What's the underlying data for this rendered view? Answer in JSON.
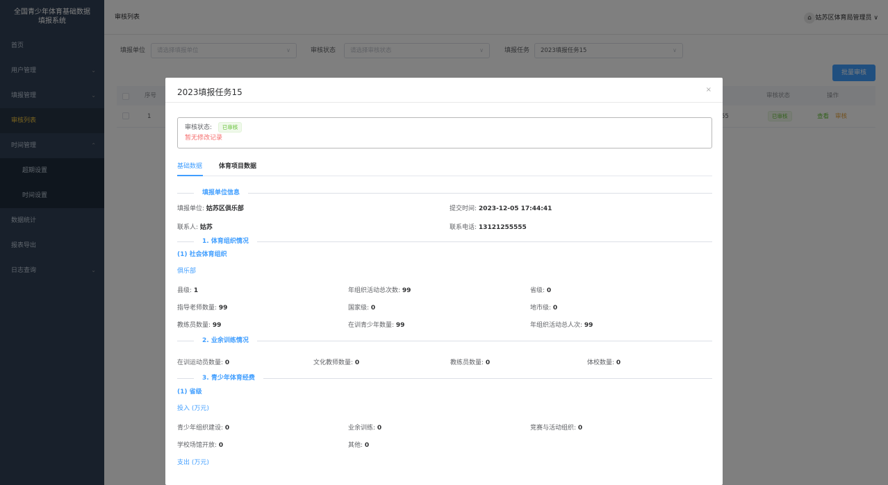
{
  "sidebar": {
    "title": "全国青少年体育基础数据填报系统",
    "items": [
      {
        "label": "首页",
        "arrow": ""
      },
      {
        "label": "用户管理",
        "arrow": "⌄"
      },
      {
        "label": "填报管理",
        "arrow": "⌄"
      },
      {
        "label": "审核列表",
        "arrow": ""
      },
      {
        "label": "时间管理",
        "arrow": "⌃"
      },
      {
        "label": "超期设置",
        "arrow": ""
      },
      {
        "label": "时间设置",
        "arrow": ""
      },
      {
        "label": "数据统计",
        "arrow": ""
      },
      {
        "label": "报表导出",
        "arrow": ""
      },
      {
        "label": "日志查询",
        "arrow": "⌄"
      }
    ]
  },
  "header": {
    "breadcrumb": "审核列表",
    "user": "姑苏区体育局管理员 ∨"
  },
  "filters": {
    "unit_label": "填报单位",
    "unit_placeholder": "请选择填报单位",
    "status_label": "审核状态",
    "status_placeholder": "请选择审核状态",
    "task_label": "填报任务",
    "task_value": "2023填报任务15"
  },
  "batch_button": "批量审核",
  "table": {
    "headers": {
      "index": "序号",
      "status": "审核状态",
      "ops": "操作"
    },
    "rows": [
      {
        "index": "1",
        "partial": "55",
        "status": "已审核",
        "view": "查看",
        "audit": "审核"
      }
    ]
  },
  "dialog": {
    "title": "2023填报任务15",
    "close": "×",
    "status_label": "审核状态:",
    "status_tag": "已审核",
    "no_modify": "暂无修改记录",
    "tabs": [
      "基础数据",
      "体育项目数据"
    ],
    "section_unit": "填报单位信息",
    "unit_label": "填报单位:",
    "unit_value": "姑苏区俱乐部",
    "submit_label": "提交时间:",
    "submit_value": "2023-12-05 17:44:41",
    "contact_label": "联系人:",
    "contact_value": "姑苏",
    "phone_label": "联系电话:",
    "phone_value": "13121255555",
    "section1": "1. 体育组织情况",
    "sub1": "(1) 社会体育组织",
    "club": "俱乐部",
    "club_fields": [
      {
        "label": "县级:",
        "value": "1"
      },
      {
        "label": "年组织活动总次数:",
        "value": "99"
      },
      {
        "label": "省级:",
        "value": "0"
      },
      {
        "label": "指导老师数量:",
        "value": "99"
      },
      {
        "label": "国家级:",
        "value": "0"
      },
      {
        "label": "地市级:",
        "value": "0"
      },
      {
        "label": "教练员数量:",
        "value": "99"
      },
      {
        "label": "在训青少年数量:",
        "value": "99"
      },
      {
        "label": "年组织活动总人次:",
        "value": "99"
      }
    ],
    "section2": "2. 业余训练情况",
    "training_fields": [
      {
        "label": "在训运动员数量:",
        "value": "0"
      },
      {
        "label": "文化教师数量:",
        "value": "0"
      },
      {
        "label": "教练员数量:",
        "value": "0"
      },
      {
        "label": "体校数量:",
        "value": "0"
      }
    ],
    "section3": "3. 青少年体育经费",
    "sub3": "(1) 省级",
    "input_label": "投入 (万元)",
    "fund_fields": [
      {
        "label": "青少年组织建设:",
        "value": "0"
      },
      {
        "label": "业余训练:",
        "value": "0"
      },
      {
        "label": "竞赛与活动组织:",
        "value": "0"
      },
      {
        "label": "学校场馆开放:",
        "value": "0"
      },
      {
        "label": "其他:",
        "value": "0"
      }
    ],
    "output_label": "支出 (万元)"
  }
}
